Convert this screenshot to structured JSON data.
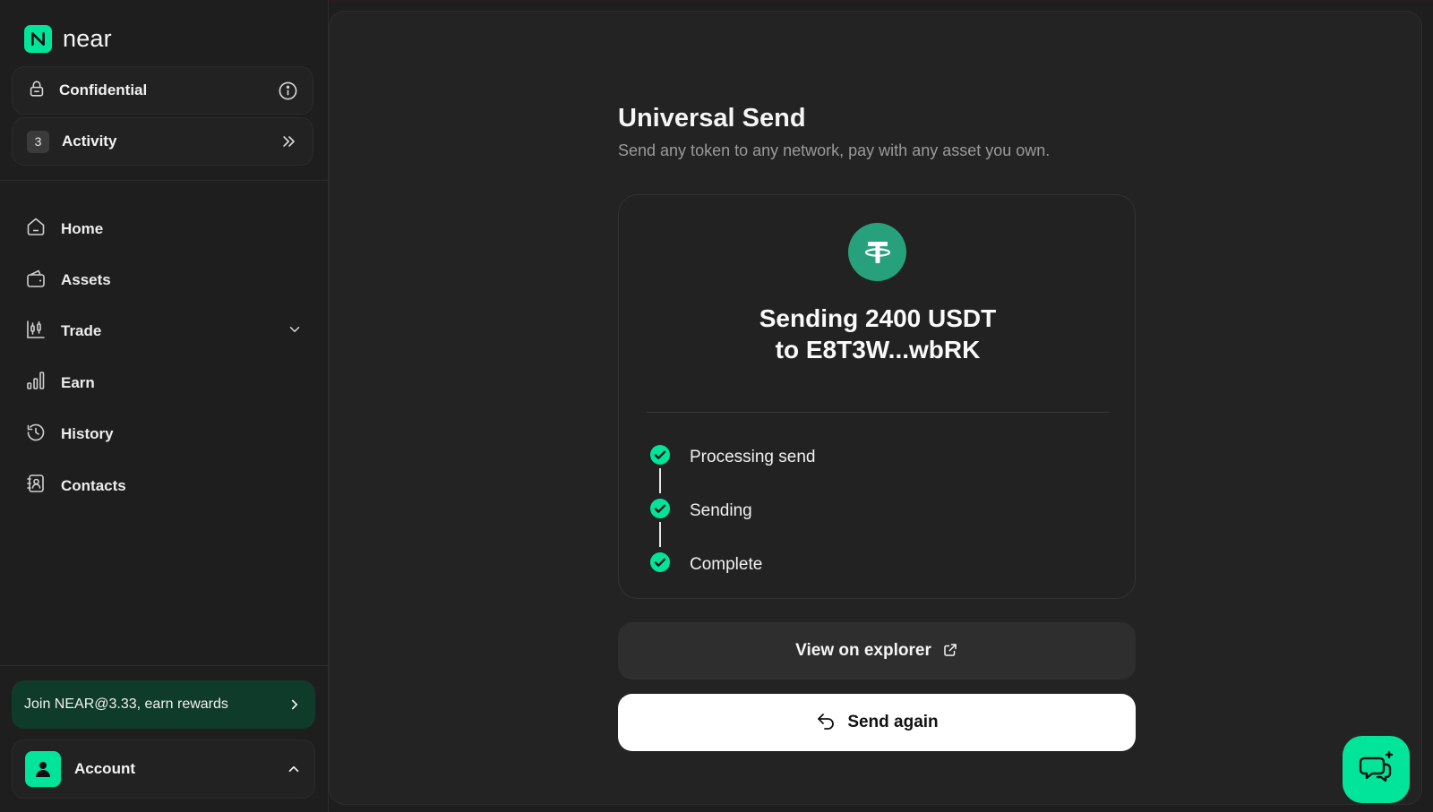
{
  "brand": {
    "name": "near",
    "accent": "#00e599"
  },
  "sidebar": {
    "confidential": {
      "label": "Confidential",
      "icon": "lock-icon",
      "info_icon": "info-icon"
    },
    "activity": {
      "count": "3",
      "label": "Activity",
      "icon": "double-chevron-right-icon"
    },
    "nav": [
      {
        "label": "Home",
        "icon": "home-icon"
      },
      {
        "label": "Assets",
        "icon": "wallet-icon"
      },
      {
        "label": "Trade",
        "icon": "candlestick-icon",
        "expandable": true
      },
      {
        "label": "Earn",
        "icon": "bar-chart-icon"
      },
      {
        "label": "History",
        "icon": "history-icon"
      },
      {
        "label": "Contacts",
        "icon": "contacts-icon"
      }
    ],
    "promo": {
      "label": "Join NEAR@3.33, earn rewards",
      "bg": "#0f3b2a"
    },
    "account": {
      "label": "Account"
    }
  },
  "main": {
    "title": "Universal Send",
    "subtitle": "Send any token to any network, pay with any asset you own.",
    "status": {
      "token_icon": "tether-icon",
      "token_color": "#26a17b",
      "line1": "Sending 2400 USDT",
      "line2": "to E8T3W...wbRK",
      "steps": [
        {
          "label": "Processing send",
          "done": true
        },
        {
          "label": "Sending",
          "done": true
        },
        {
          "label": "Complete",
          "done": true
        }
      ]
    },
    "explorer_label": "View on explorer",
    "send_again_label": "Send again"
  }
}
